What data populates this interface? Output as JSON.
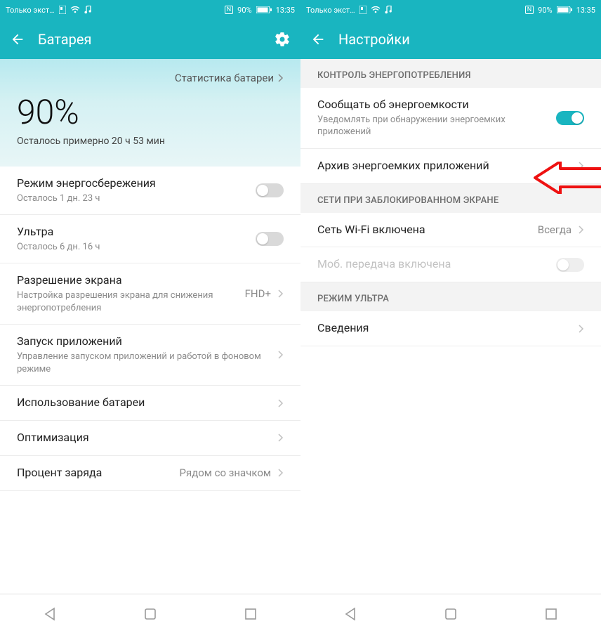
{
  "left": {
    "status": {
      "carrier": "Только экстр…",
      "nfc": "N",
      "battery_pct": "90%",
      "time": "13:35"
    },
    "header": {
      "title": "Батарея"
    },
    "hero": {
      "stats_link": "Статистика батареи",
      "percent": "90%",
      "remaining": "Осталось примерно 20 ч 53 мин"
    },
    "rows": {
      "power_save": {
        "title": "Режим энергосбережения",
        "sub": "Осталось 1 дн. 23 ч"
      },
      "ultra": {
        "title": "Ультра",
        "sub": "Осталось 6 дн. 16 ч"
      },
      "resolution": {
        "title": "Разрешение экрана",
        "sub": "Настройка разрешения экрана для снижения энергопотребления",
        "value": "FHD+"
      },
      "launch": {
        "title": "Запуск приложений",
        "sub": "Управление запуском приложений и работой в фоновом режиме"
      },
      "usage": {
        "title": "Использование батареи"
      },
      "optimize": {
        "title": "Оптимизация"
      },
      "percent_row": {
        "title": "Процент заряда",
        "value": "Рядом со значком"
      }
    }
  },
  "right": {
    "status": {
      "carrier": "Только экстр…",
      "nfc": "N",
      "battery_pct": "90%",
      "time": "13:35"
    },
    "header": {
      "title": "Настройки"
    },
    "sections": {
      "s1": "КОНТРОЛЬ ЭНЕРГОПОТРЕБЛЕНИЯ",
      "s2": "СЕТИ ПРИ ЗАБЛОКИРОВАННОМ ЭКРАНЕ",
      "s3": "РЕЖИМ УЛЬТРА"
    },
    "rows": {
      "notify": {
        "title": "Сообщать об энергоемкости",
        "sub": "Уведомлять при обнаружении энергоемких приложений"
      },
      "archive": {
        "title": "Архив энергоемких приложений"
      },
      "wifi": {
        "title": "Сеть Wi-Fi включена",
        "value": "Всегда"
      },
      "mobile": {
        "title": "Моб. передача включена"
      },
      "info": {
        "title": "Сведения"
      }
    }
  }
}
